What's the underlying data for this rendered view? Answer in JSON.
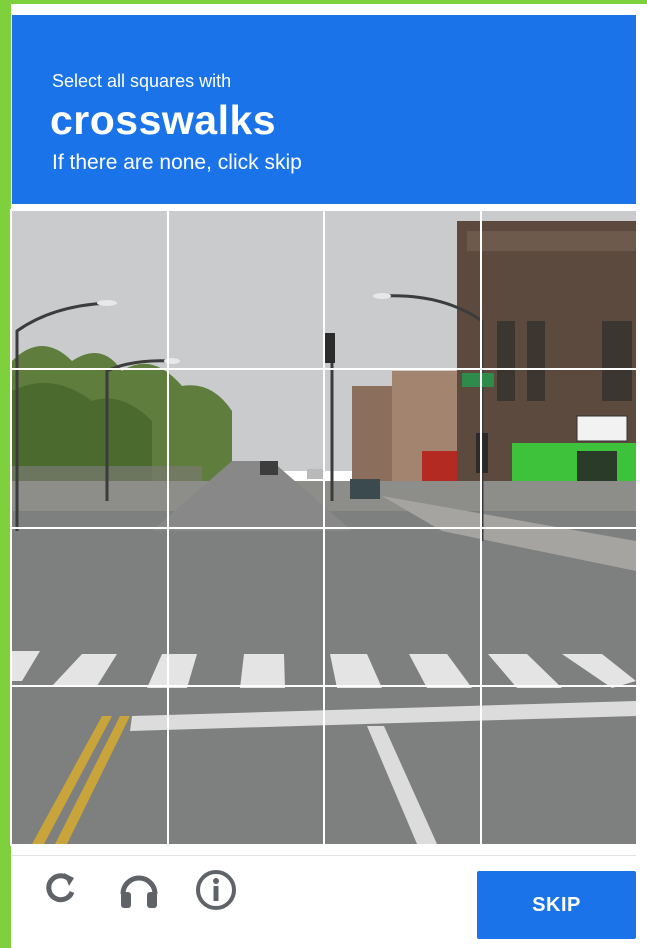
{
  "header": {
    "instruction": "Select all squares with",
    "target": "crosswalks",
    "note": "If there are none, click skip"
  },
  "grid": {
    "rows": 4,
    "cols": 4,
    "tiles": [
      {
        "row": 1,
        "col": 1
      },
      {
        "row": 1,
        "col": 2
      },
      {
        "row": 1,
        "col": 3
      },
      {
        "row": 1,
        "col": 4
      },
      {
        "row": 2,
        "col": 1
      },
      {
        "row": 2,
        "col": 2
      },
      {
        "row": 2,
        "col": 3
      },
      {
        "row": 2,
        "col": 4
      },
      {
        "row": 3,
        "col": 1
      },
      {
        "row": 3,
        "col": 2
      },
      {
        "row": 3,
        "col": 3
      },
      {
        "row": 3,
        "col": 4
      },
      {
        "row": 4,
        "col": 1
      },
      {
        "row": 4,
        "col": 2
      },
      {
        "row": 4,
        "col": 3
      },
      {
        "row": 4,
        "col": 4
      }
    ]
  },
  "footer": {
    "skip_label": "SKIP",
    "icons": [
      "reload-icon",
      "audio-icon",
      "info-icon"
    ]
  },
  "colors": {
    "accent": "#1a73e8",
    "outer_border": "#7ed13c",
    "icon_gray": "#5f6368"
  }
}
